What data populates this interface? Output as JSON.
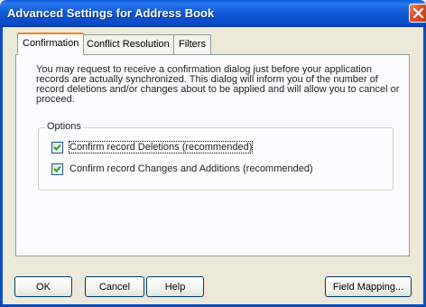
{
  "window": {
    "title": "Advanced Settings for Address Book"
  },
  "tabs": [
    {
      "label": "Confirmation",
      "active": true
    },
    {
      "label": "Conflict Resolution",
      "active": false
    },
    {
      "label": "Filters",
      "active": false
    }
  ],
  "confirmation": {
    "description": "You may request to receive a confirmation dialog just before your application records are actually synchronized.  This dialog will inform you of the number of record deletions and/or changes about to be applied and will allow you to cancel or proceed.",
    "options_label": "Options",
    "options": [
      {
        "label": "Confirm record Deletions (recommended)",
        "checked": true
      },
      {
        "label": "Confirm record Changes and Additions (recommended)",
        "checked": true
      }
    ]
  },
  "buttons": {
    "ok": "OK",
    "cancel": "Cancel",
    "help": "Help",
    "field_mapping": "Field Mapping..."
  },
  "colors": {
    "titlebar": "#0a5fd8",
    "dialog_bg": "#ece9d8",
    "tab_highlight": "#e68b2c"
  }
}
